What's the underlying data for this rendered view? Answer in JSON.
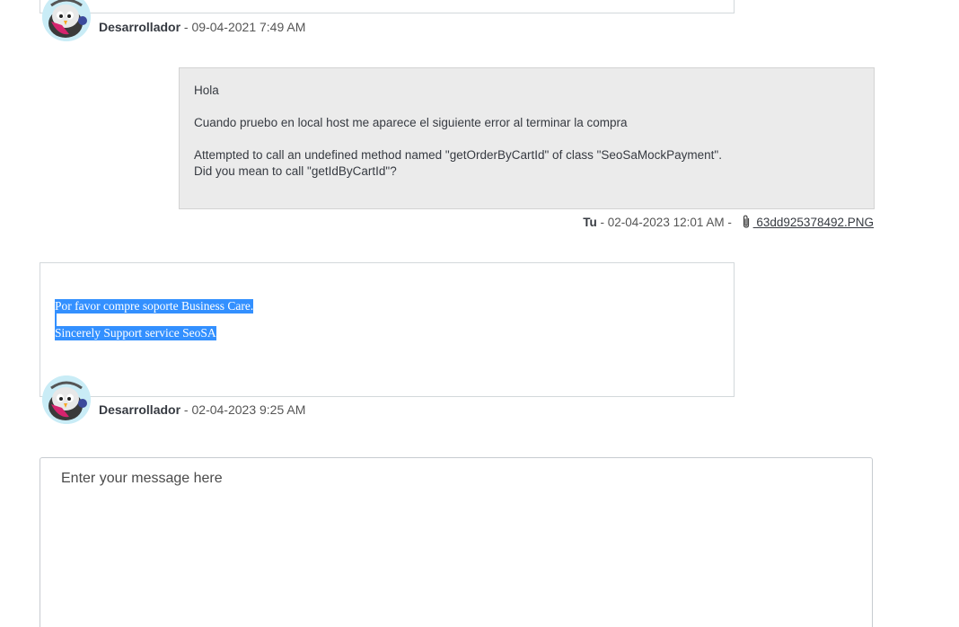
{
  "messages": [
    {
      "author": "Desarrollador",
      "separator": " - ",
      "date": "09-04-2021 7:49 AM"
    },
    {
      "lines": [
        "Hola",
        "Cuando pruebo en local host me aparece el siguiente error al terminar la compra",
        "Attempted to call an undefined method named \"getOrderByCartId\" of class \"SeoSaMockPayment\".",
        "Did you mean to call \"getIdByCartId\"?"
      ],
      "author": "Tu",
      "separator": " - ",
      "date": "02-04-2023 12:01 AM",
      "separator2": " - ",
      "attachment": " 63dd925378492.PNG"
    },
    {
      "lines": [
        "Por favor compre soporte Business Care. ",
        "Sincerely Support service SeoSA"
      ],
      "author": "Desarrollador",
      "separator": " - ",
      "date": "02-04-2023 9:25 AM"
    }
  ],
  "composer": {
    "placeholder": "Enter your message here"
  },
  "icons": {
    "avatar": "support-mascot-icon",
    "attachment": "paperclip-icon"
  },
  "colors": {
    "selection": "#3390ff",
    "customer_bg": "#ebebeb",
    "avatar_bg": "#c9ecf6"
  }
}
